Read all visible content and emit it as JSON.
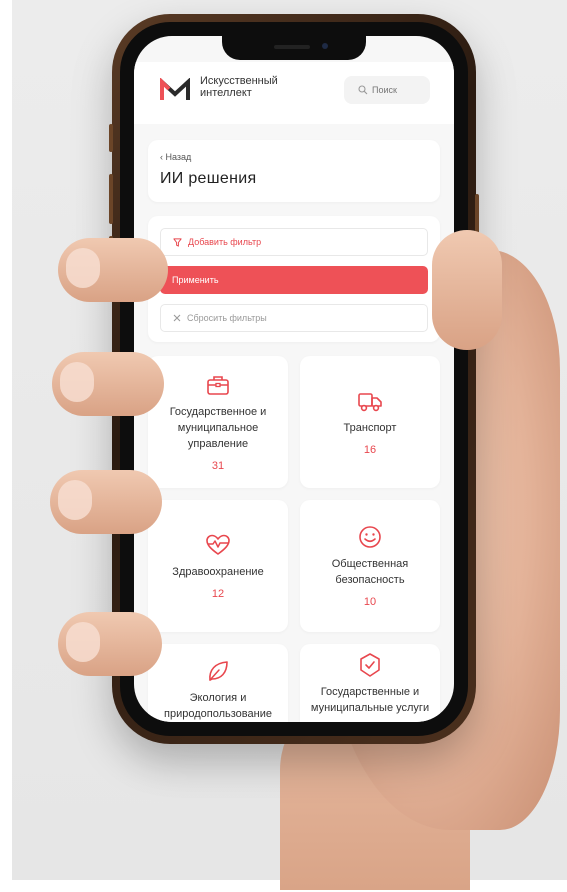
{
  "app": {
    "brand_line1": "Искусственный",
    "brand_line2": "интеллект",
    "search_placeholder": "Поиск"
  },
  "page": {
    "back_label": "Назад",
    "title": "ИИ решения"
  },
  "filters": {
    "add_label": "Добавить фильтр",
    "apply_label": "Применить",
    "reset_label": "Сбросить фильтры"
  },
  "categories": [
    {
      "name": "Государственное и муниципальное управление",
      "count": "31",
      "icon": "briefcase-icon"
    },
    {
      "name": "Транспорт",
      "count": "16",
      "icon": "truck-icon"
    },
    {
      "name": "Здравоохранение",
      "count": "12",
      "icon": "heart-pulse-icon"
    },
    {
      "name": "Общественная безопасность",
      "count": "10",
      "icon": "smile-icon"
    },
    {
      "name": "Экология и природопользование",
      "count": "",
      "icon": "leaf-icon"
    },
    {
      "name": "Государственные и муниципальные услуги",
      "count": "",
      "icon": "shield-check-icon"
    }
  ],
  "colors": {
    "accent": "#ee5157",
    "accent_text": "#e8474e",
    "brand_dark": "#2b2b2b"
  }
}
